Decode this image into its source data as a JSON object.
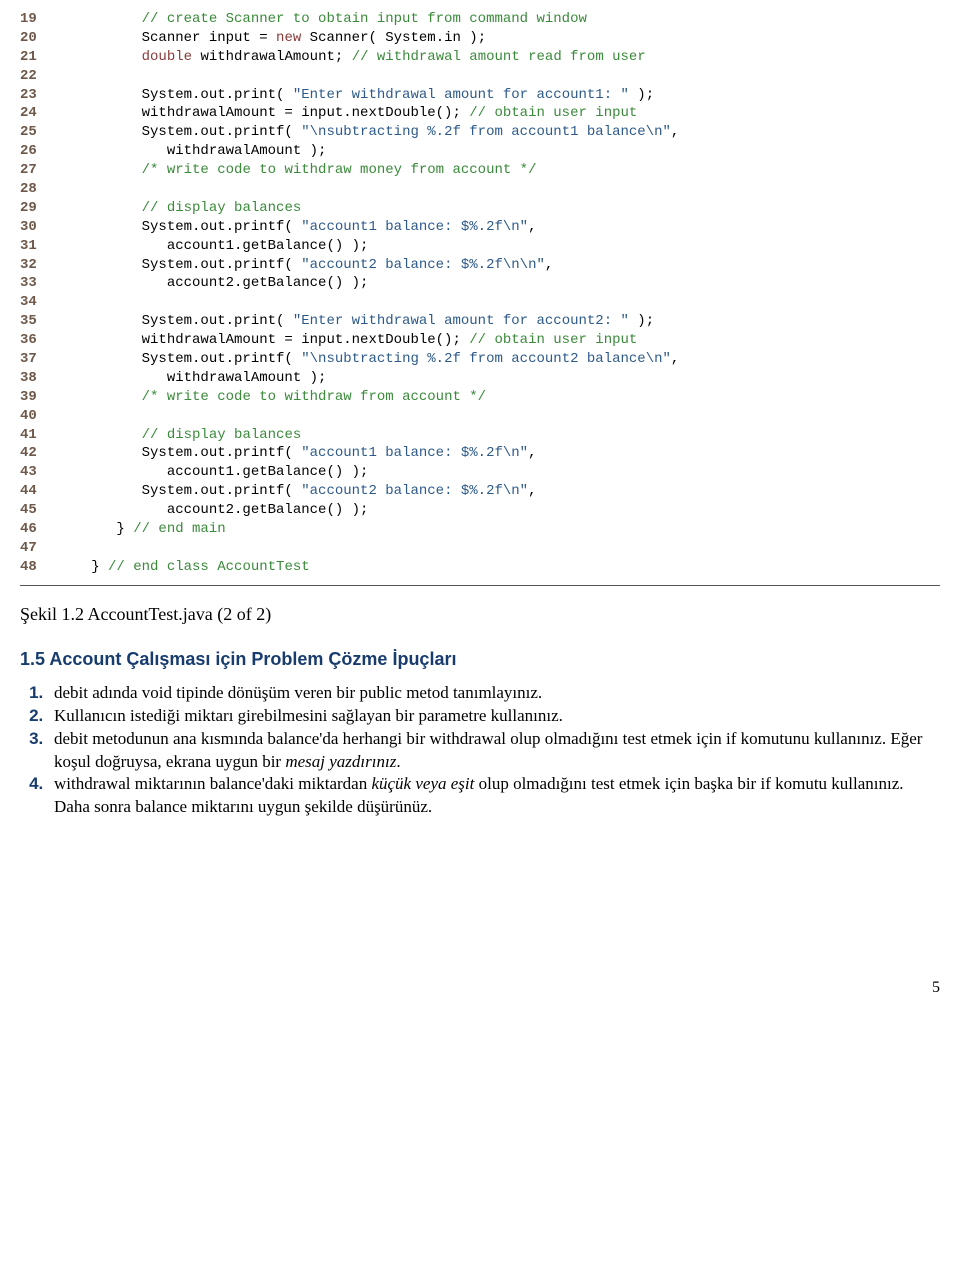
{
  "code": {
    "lines": [
      {
        "n": "19",
        "seg": [
          {
            "c": "c-green",
            "t": "         // create Scanner to obtain input from command window"
          }
        ]
      },
      {
        "n": "20",
        "seg": [
          {
            "c": "c-black",
            "t": "         Scanner input = "
          },
          {
            "c": "c-red",
            "t": "new"
          },
          {
            "c": "c-black",
            "t": " Scanner( System.in );"
          }
        ]
      },
      {
        "n": "21",
        "seg": [
          {
            "c": "c-black",
            "t": "         "
          },
          {
            "c": "c-red",
            "t": "double"
          },
          {
            "c": "c-black",
            "t": " withdrawalAmount; "
          },
          {
            "c": "c-green",
            "t": "// withdrawal amount read from user"
          }
        ]
      },
      {
        "n": "22",
        "seg": [
          {
            "c": "c-black",
            "t": ""
          }
        ]
      },
      {
        "n": "23",
        "seg": [
          {
            "c": "c-black",
            "t": "         System.out.print( "
          },
          {
            "c": "c-blue",
            "t": "\"Enter withdrawal amount for account1: \""
          },
          {
            "c": "c-black",
            "t": " );"
          }
        ]
      },
      {
        "n": "24",
        "seg": [
          {
            "c": "c-black",
            "t": "         withdrawalAmount = input.nextDouble(); "
          },
          {
            "c": "c-green",
            "t": "// obtain user input"
          }
        ]
      },
      {
        "n": "25",
        "seg": [
          {
            "c": "c-black",
            "t": "         System.out.printf( "
          },
          {
            "c": "c-blue",
            "t": "\"\\nsubtracting %.2f from account1 balance\\n\""
          },
          {
            "c": "c-black",
            "t": ","
          }
        ]
      },
      {
        "n": "26",
        "seg": [
          {
            "c": "c-black",
            "t": "            withdrawalAmount );"
          }
        ]
      },
      {
        "n": "27",
        "seg": [
          {
            "c": "c-black",
            "t": "         "
          },
          {
            "c": "c-green",
            "t": "/* write code to withdraw money from account */"
          }
        ]
      },
      {
        "n": "28",
        "seg": [
          {
            "c": "c-black",
            "t": ""
          }
        ]
      },
      {
        "n": "29",
        "seg": [
          {
            "c": "c-black",
            "t": "         "
          },
          {
            "c": "c-green",
            "t": "// display balances"
          }
        ]
      },
      {
        "n": "30",
        "seg": [
          {
            "c": "c-black",
            "t": "         System.out.printf( "
          },
          {
            "c": "c-blue",
            "t": "\"account1 balance: $%.2f\\n\""
          },
          {
            "c": "c-black",
            "t": ","
          }
        ]
      },
      {
        "n": "31",
        "seg": [
          {
            "c": "c-black",
            "t": "            account1.getBalance() );"
          }
        ]
      },
      {
        "n": "32",
        "seg": [
          {
            "c": "c-black",
            "t": "         System.out.printf( "
          },
          {
            "c": "c-blue",
            "t": "\"account2 balance: $%.2f\\n\\n\""
          },
          {
            "c": "c-black",
            "t": ","
          }
        ]
      },
      {
        "n": "33",
        "seg": [
          {
            "c": "c-black",
            "t": "            account2.getBalance() );"
          }
        ]
      },
      {
        "n": "34",
        "seg": [
          {
            "c": "c-black",
            "t": ""
          }
        ]
      },
      {
        "n": "35",
        "seg": [
          {
            "c": "c-black",
            "t": "         System.out.print( "
          },
          {
            "c": "c-blue",
            "t": "\"Enter withdrawal amount for account2: \""
          },
          {
            "c": "c-black",
            "t": " );"
          }
        ]
      },
      {
        "n": "36",
        "seg": [
          {
            "c": "c-black",
            "t": "         withdrawalAmount = input.nextDouble(); "
          },
          {
            "c": "c-green",
            "t": "// obtain user input"
          }
        ]
      },
      {
        "n": "37",
        "seg": [
          {
            "c": "c-black",
            "t": "         System.out.printf( "
          },
          {
            "c": "c-blue",
            "t": "\"\\nsubtracting %.2f from account2 balance\\n\""
          },
          {
            "c": "c-black",
            "t": ","
          }
        ]
      },
      {
        "n": "38",
        "seg": [
          {
            "c": "c-black",
            "t": "            withdrawalAmount );"
          }
        ]
      },
      {
        "n": "39",
        "seg": [
          {
            "c": "c-black",
            "t": "         "
          },
          {
            "c": "c-green",
            "t": "/* write code to withdraw from account */"
          }
        ]
      },
      {
        "n": "40",
        "seg": [
          {
            "c": "c-black",
            "t": ""
          }
        ]
      },
      {
        "n": "41",
        "seg": [
          {
            "c": "c-black",
            "t": "         "
          },
          {
            "c": "c-green",
            "t": "// display balances"
          }
        ]
      },
      {
        "n": "42",
        "seg": [
          {
            "c": "c-black",
            "t": "         System.out.printf( "
          },
          {
            "c": "c-blue",
            "t": "\"account1 balance: $%.2f\\n\""
          },
          {
            "c": "c-black",
            "t": ","
          }
        ]
      },
      {
        "n": "43",
        "seg": [
          {
            "c": "c-black",
            "t": "            account1.getBalance() );"
          }
        ]
      },
      {
        "n": "44",
        "seg": [
          {
            "c": "c-black",
            "t": "         System.out.printf( "
          },
          {
            "c": "c-blue",
            "t": "\"account2 balance: $%.2f\\n\""
          },
          {
            "c": "c-black",
            "t": ","
          }
        ]
      },
      {
        "n": "45",
        "seg": [
          {
            "c": "c-black",
            "t": "            account2.getBalance() );"
          }
        ]
      },
      {
        "n": "46",
        "seg": [
          {
            "c": "c-black",
            "t": "      } "
          },
          {
            "c": "c-green",
            "t": "// end main"
          }
        ]
      },
      {
        "n": "47",
        "seg": [
          {
            "c": "c-black",
            "t": ""
          }
        ]
      },
      {
        "n": "48",
        "seg": [
          {
            "c": "c-black",
            "t": "   } "
          },
          {
            "c": "c-green",
            "t": "// end class AccountTest"
          }
        ]
      }
    ]
  },
  "caption": "Şekil 1.2 AccountTest.java (2 of 2)",
  "section_title": "1.5 Account Çalışması için Problem Çözme İpuçları",
  "tips": [
    {
      "pre": " debit adında void tipinde dönüşüm veren bir public metod tanımlayınız.",
      "italic": "",
      "post": ""
    },
    {
      "pre": " Kullanıcın istediği miktarı girebilmesini sağlayan bir parametre kullanınız.",
      "italic": "",
      "post": ""
    },
    {
      "pre": "  debit metodunun ana kısmında balance'da herhangi bir withdrawal olup olmadığını test etmek için if komutunu kullanınız. Eğer koşul doğruysa, ekrana uygun bir ",
      "italic": "mesaj yazdırınız",
      "post": "."
    },
    {
      "pre": "  withdrawal miktarının balance'daki miktardan ",
      "italic": "küçük veya eşit",
      "post": " olup olmadığını test etmek için başka bir if komutu kullanınız. Daha sonra balance miktarını uygun şekilde düşürünüz."
    }
  ],
  "page_number": "5"
}
